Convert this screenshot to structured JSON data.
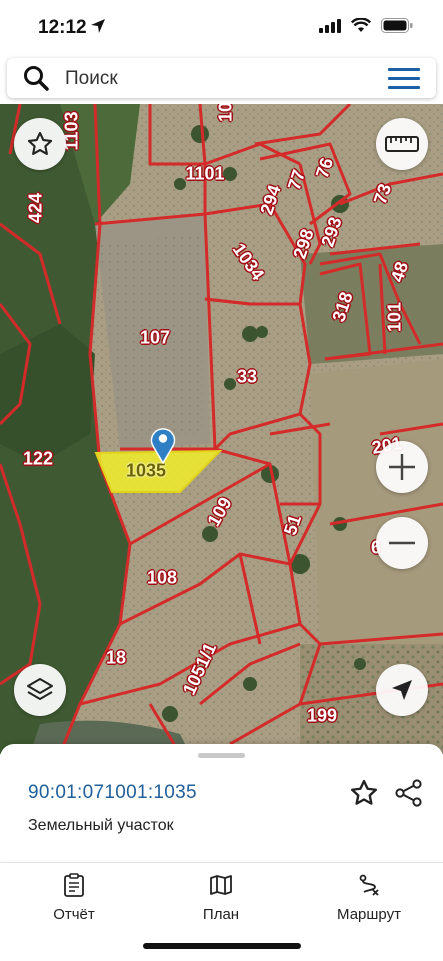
{
  "status_bar": {
    "time": "12:12"
  },
  "search": {
    "placeholder": "Поиск"
  },
  "map": {
    "parcel_labels": [
      {
        "name": "1101",
        "text": "1101"
      },
      {
        "name": "77",
        "text": "77"
      },
      {
        "name": "76",
        "text": "76"
      },
      {
        "name": "294",
        "text": "294"
      },
      {
        "name": "73",
        "text": "73"
      },
      {
        "name": "293",
        "text": "293"
      },
      {
        "name": "298",
        "text": "298"
      },
      {
        "name": "1034",
        "text": "1034"
      },
      {
        "name": "48",
        "text": "48"
      },
      {
        "name": "318",
        "text": "318"
      },
      {
        "name": "101",
        "text": "101"
      },
      {
        "name": "107",
        "text": "107"
      },
      {
        "name": "33",
        "text": "33"
      },
      {
        "name": "424",
        "text": "424"
      },
      {
        "name": "1103",
        "text": "1103"
      },
      {
        "name": "122",
        "text": "122"
      },
      {
        "name": "1035",
        "text": "1035"
      },
      {
        "name": "109",
        "text": "109"
      },
      {
        "name": "51",
        "text": "51"
      },
      {
        "name": "201",
        "text": "201"
      },
      {
        "name": "108",
        "text": "108"
      },
      {
        "name": "18",
        "text": "18"
      },
      {
        "name": "1051-1",
        "text": "1051/1"
      },
      {
        "name": "199",
        "text": "199"
      },
      {
        "name": "10",
        "text": "10"
      },
      {
        "name": "6",
        "text": "6"
      }
    ],
    "selected_parcel": "1035",
    "colors": {
      "boundary": "#d42a2a",
      "selected_fill": "#f0ec2a",
      "pin": "#2f7fc4"
    }
  },
  "sheet": {
    "cadastral_number": "90:01:071001:1035",
    "object_type": "Земельный участок"
  },
  "tabs": [
    {
      "id": "report",
      "label": "Отчёт",
      "icon": "clipboard-icon"
    },
    {
      "id": "plan",
      "label": "План",
      "icon": "map-icon"
    },
    {
      "id": "route",
      "label": "Маршрут",
      "icon": "route-icon"
    }
  ]
}
